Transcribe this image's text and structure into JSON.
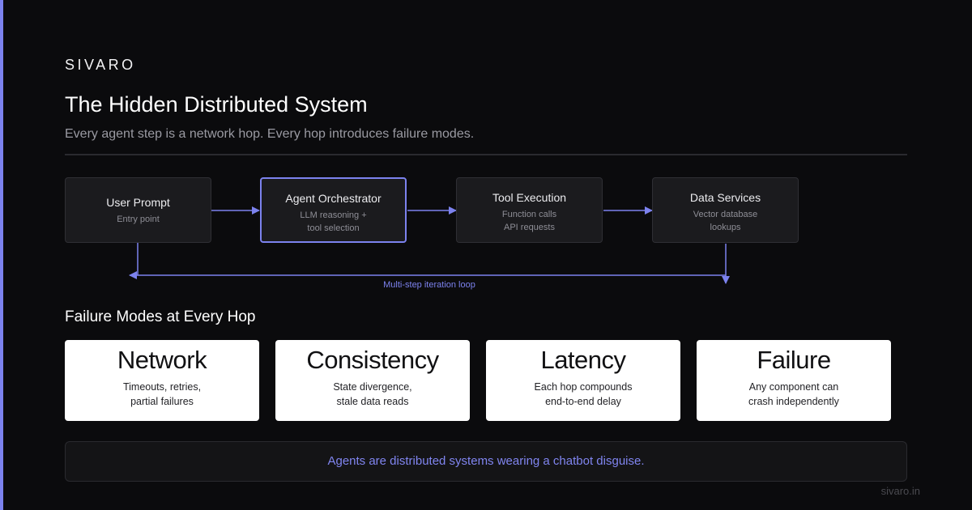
{
  "brand": "SIVARO",
  "title": "The Hidden Distributed System",
  "subtitle": "Every agent step is a network hop. Every hop introduces failure modes.",
  "colors": {
    "accent": "#7c82ee",
    "background": "#0b0b0d",
    "node_fill": "#1b1b1e",
    "card_fill": "#ffffff"
  },
  "flow": {
    "nodes": [
      {
        "title": "User Prompt",
        "desc": "Entry point"
      },
      {
        "title": "Agent Orchestrator",
        "desc": "LLM reasoning +\ntool selection"
      },
      {
        "title": "Tool Execution",
        "desc": "Function calls\nAPI requests"
      },
      {
        "title": "Data Services",
        "desc": "Vector database\nlookups"
      }
    ],
    "loop_label": "Multi-step iteration loop"
  },
  "failure_section": {
    "title": "Failure Modes at Every Hop",
    "cards": [
      {
        "title": "Network",
        "desc": "Timeouts, retries,\npartial failures"
      },
      {
        "title": "Consistency",
        "desc": "State divergence,\nstale data reads"
      },
      {
        "title": "Latency",
        "desc": "Each hop compounds\nend-to-end delay"
      },
      {
        "title": "Failure",
        "desc": "Any component can\ncrash independently"
      }
    ]
  },
  "callout": "Agents are distributed systems wearing a chatbot disguise.",
  "footer": "sivaro.in"
}
